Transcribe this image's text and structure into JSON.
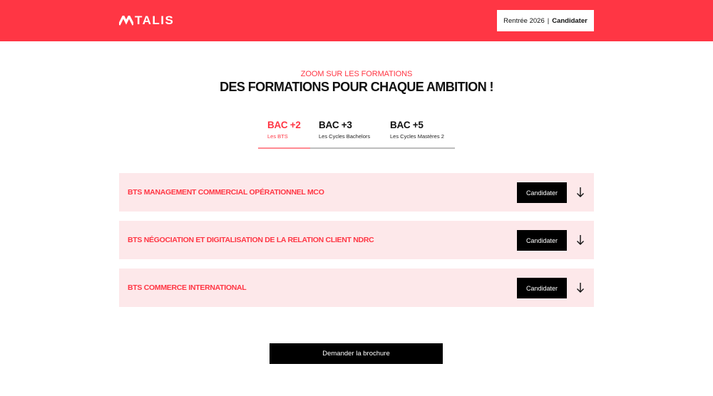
{
  "header": {
    "logo_text": "TALIS",
    "cta_prefix": "Rentrée 2026",
    "cta_separator": "|",
    "cta_label": "Candidater"
  },
  "section": {
    "eyebrow": "ZOOM SUR LES FORMATIONS",
    "title": "DES FORMATIONS POUR CHAQUE AMBITION !"
  },
  "tabs": [
    {
      "title": "BAC +2",
      "subtitle": "Les BTS",
      "active": true
    },
    {
      "title": "BAC +3",
      "subtitle": "Les Cycles Bachelors",
      "active": false
    },
    {
      "title": "BAC +5",
      "subtitle": "Les Cycles Mastères 2",
      "active": false
    }
  ],
  "formations": [
    {
      "title": "BTS MANAGEMENT COMMERCIAL OPÉRATIONNEL MCO",
      "button_label": "Candidater"
    },
    {
      "title": "BTS NÉGOCIATION ET DIGITALISATION DE LA RELATION CLIENT NDRC",
      "button_label": "Candidater"
    },
    {
      "title": "BTS COMMERCE INTERNATIONAL",
      "button_label": "Candidater"
    }
  ],
  "brochure_label": "Demander la brochure",
  "colors": {
    "brand": "#ff3644",
    "accordion_bg": "#fde8ea",
    "button_bg": "#000000"
  },
  "icons": {
    "logo_mark": "talis-mark-icon",
    "expand": "arrow-down-icon"
  }
}
